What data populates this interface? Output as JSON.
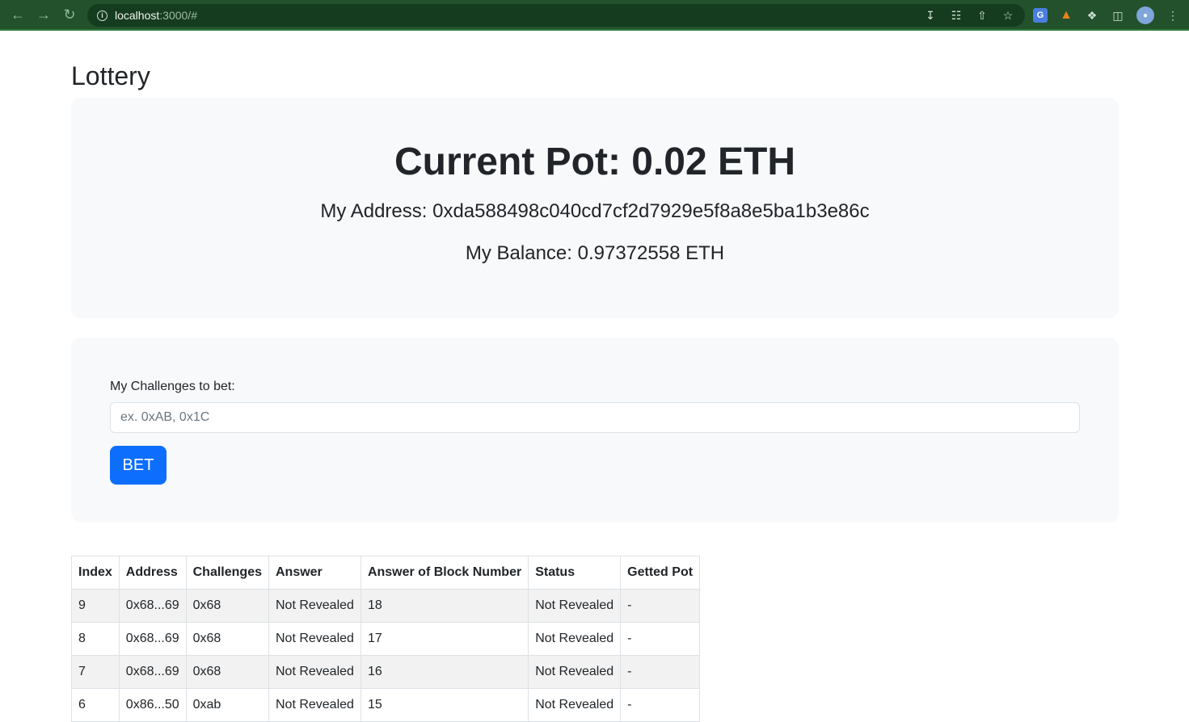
{
  "browser": {
    "url_host": "localhost",
    "url_path": ":3000/#"
  },
  "page": {
    "title": "Lottery"
  },
  "pot": {
    "title": "Current Pot: 0.02 ETH",
    "address_line": "My Address: 0xda588498c040cd7cf2d7929e5f8a8e5ba1b3e86c",
    "balance_line": "My Balance: 0.97372558 ETH"
  },
  "bet": {
    "label": "My Challenges to bet:",
    "placeholder": "ex. 0xAB, 0x1C",
    "value": "",
    "button_label": "BET"
  },
  "table": {
    "headers": [
      "Index",
      "Address",
      "Challenges",
      "Answer",
      "Answer of Block Number",
      "Status",
      "Getted Pot"
    ],
    "rows": [
      [
        "9",
        "0x68...69",
        "0x68",
        "Not Revealed",
        "18",
        "Not Revealed",
        "-"
      ],
      [
        "8",
        "0x68...69",
        "0x68",
        "Not Revealed",
        "17",
        "Not Revealed",
        "-"
      ],
      [
        "7",
        "0x68...69",
        "0x68",
        "Not Revealed",
        "16",
        "Not Revealed",
        "-"
      ],
      [
        "6",
        "0x86...50",
        "0xab",
        "Not Revealed",
        "15",
        "Not Revealed",
        "-"
      ]
    ]
  }
}
